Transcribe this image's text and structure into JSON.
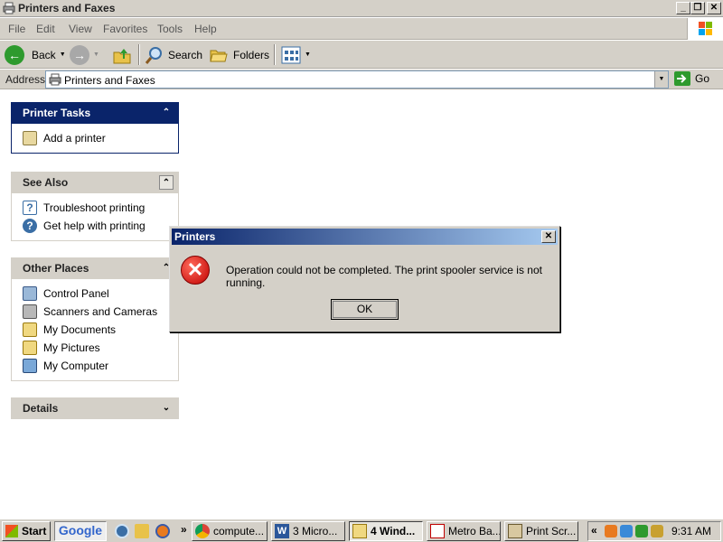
{
  "window": {
    "title": "Printers and Faxes",
    "min_label": "_",
    "restore_label": "❐",
    "close_label": "✕"
  },
  "menu": [
    "File",
    "Edit",
    "View",
    "Favorites",
    "Tools",
    "Help"
  ],
  "toolbar": {
    "back_label": "Back",
    "search_label": "Search",
    "folders_label": "Folders"
  },
  "address": {
    "label": "Address",
    "value": "Printers and Faxes",
    "go_label": "Go"
  },
  "panes": {
    "printer_tasks": {
      "title": "Printer Tasks",
      "chevron": "⌃",
      "items": [
        "Add a printer"
      ]
    },
    "see_also": {
      "title": "See Also",
      "chevron": "⌃",
      "items": [
        "Troubleshoot printing",
        "Get help with printing"
      ]
    },
    "other_places": {
      "title": "Other Places",
      "chevron": "⌃",
      "items": [
        "Control Panel",
        "Scanners and Cameras",
        "My Documents",
        "My Pictures",
        "My Computer"
      ]
    },
    "details": {
      "title": "Details",
      "chevron": "⌄"
    }
  },
  "dialog": {
    "title": "Printers",
    "close_label": "✕",
    "error_icon": "✕",
    "message": "Operation could not be completed. The print spooler service is not running.",
    "ok_label": "OK"
  },
  "taskbar": {
    "start_label": "Start",
    "google_label": "Google",
    "overflow": "»",
    "tray_chevron": "«",
    "buttons": [
      {
        "label": "compute...",
        "icon": "chrome-icon"
      },
      {
        "label": "3 Micro...",
        "icon": "word-icon"
      },
      {
        "label": "4 Wind...",
        "icon": "folder-icon"
      },
      {
        "label": "Metro Ba...",
        "icon": "pdf-icon"
      },
      {
        "label": "Print Scr...",
        "icon": "paint-icon"
      }
    ],
    "clock": "9:31 AM"
  },
  "colors": {
    "pane_dark": "#0a246a",
    "error_red": "#c00000",
    "chrome_face": "#d4d0c8"
  }
}
